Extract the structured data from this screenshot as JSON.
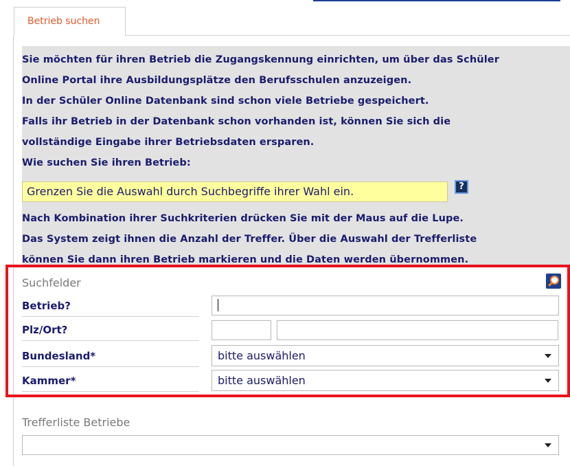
{
  "tab": {
    "label": "Betrieb suchen"
  },
  "info": {
    "lines": [
      "Sie möchten für ihren Betrieb die Zugangskennung einrichten, um über das Schüler",
      "Online Portal ihre Ausbildungsplätze den Berufsschulen anzuzeigen.",
      "In der Schüler Online Datenbank sind schon viele Betriebe gespeichert.",
      "Falls ihr Betrieb in der Datenbank schon vorhanden ist, können Sie sich die",
      "vollständige Eingabe ihrer Betriebsdaten ersparen.",
      "Wie suchen Sie ihren Betrieb:",
      "Nach Kombination ihrer Suchkriterien drücken Sie mit der Maus auf die Lupe.",
      "Das System zeigt ihnen die Anzahl der Treffer. Über die Auswahl der Trefferliste",
      "können Sie dann ihren Betrieb markieren und die Daten werden übernommen."
    ],
    "hint": "Grenzen Sie die Auswahl durch Suchbegriffe ihrer Wahl ein.",
    "help_label": "?"
  },
  "search": {
    "title": "Suchfelder",
    "betrieb_label": "Betrieb?",
    "betrieb_value": "",
    "plz_ort_label": "Plz/Ort?",
    "plz_value": "",
    "ort_value": "",
    "bundesland_label": "Bundesland*",
    "bundesland_value": "bitte auswählen",
    "kammer_label": "Kammer*",
    "kammer_value": "bitte auswählen"
  },
  "results": {
    "title": "Trefferliste Betriebe",
    "value": ""
  },
  "colors": {
    "accent": "#e2592a",
    "text": "#1b1b6e",
    "highlight_frame": "#e8141c",
    "hint_background": "#ffff9e"
  }
}
